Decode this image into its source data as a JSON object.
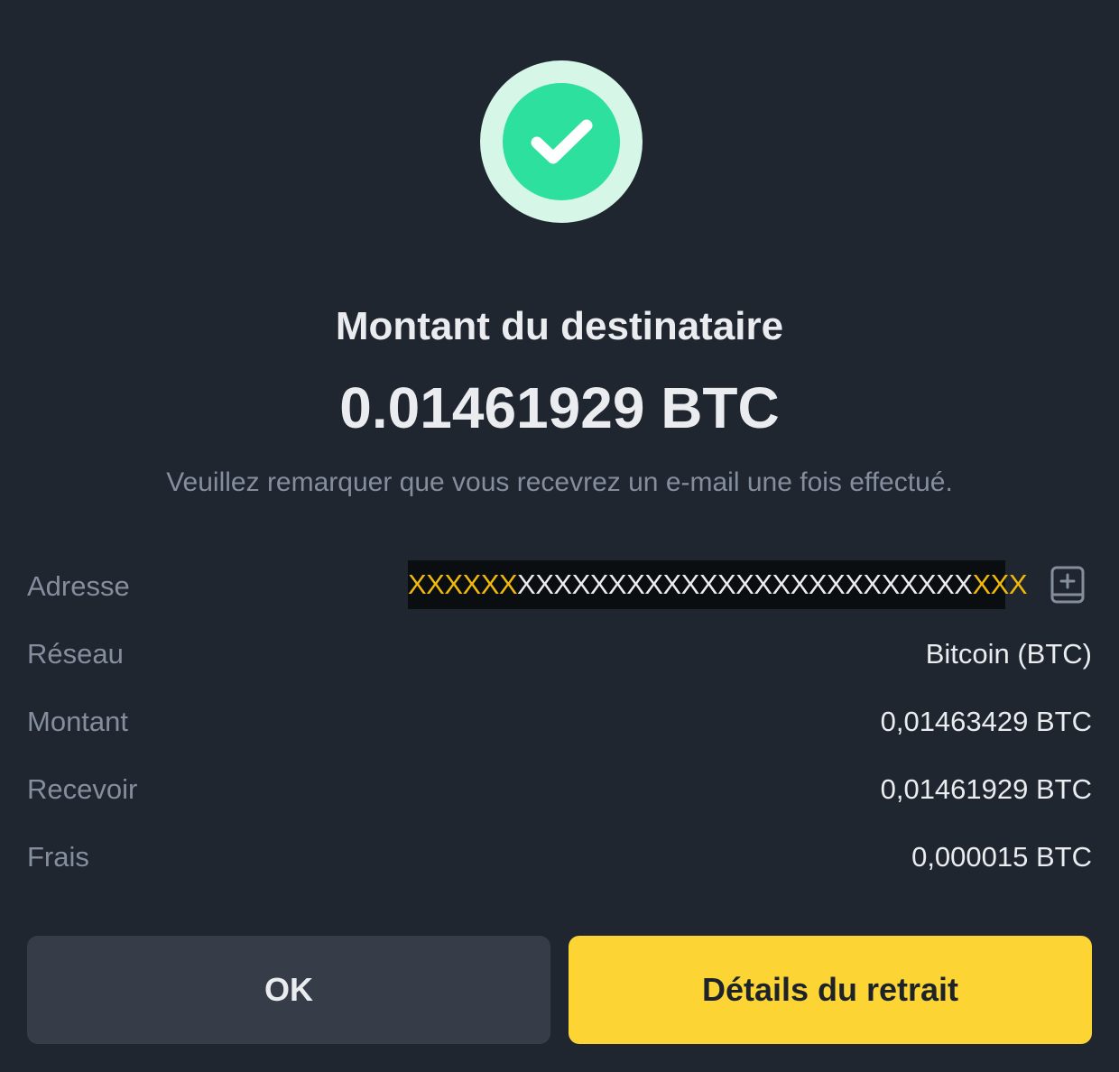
{
  "success": {
    "icon": "check-circle-icon",
    "ring_color": "#d6f6e7",
    "disc_color": "#2ee09e"
  },
  "header": {
    "title": "Montant du destinataire",
    "amount": "0.01461929 BTC",
    "note": "Veuillez remarquer que vous recevrez un e-mail une fois effectué."
  },
  "details": {
    "address": {
      "label": "Adresse",
      "value_prefix": "XXXXXX",
      "value_middle": "XXXXXXXXXXXXXXXXXXXXXXXXX",
      "value_suffix": "XXX",
      "icon": "address-book-icon"
    },
    "network": {
      "label": "Réseau",
      "value": "Bitcoin (BTC)"
    },
    "amount": {
      "label": "Montant",
      "value": "0,01463429 BTC"
    },
    "receive": {
      "label": "Recevoir",
      "value": "0,01461929 BTC"
    },
    "fee": {
      "label": "Frais",
      "value": "0,000015 BTC"
    }
  },
  "actions": {
    "ok_label": "OK",
    "details_label": "Détails du retrait"
  },
  "colors": {
    "background": "#1f2630",
    "accent": "#fcd535",
    "highlight": "#f0b90b",
    "muted_text": "#848e9c"
  }
}
